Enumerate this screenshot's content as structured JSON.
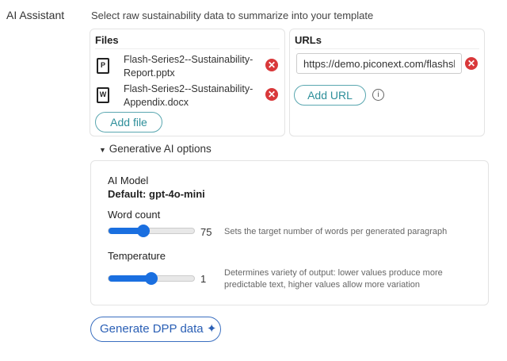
{
  "section_label": "AI Assistant",
  "intro": "Select raw sustainability data to summarize into your template",
  "files": {
    "title": "Files",
    "items": [
      {
        "icon": "P",
        "name_line1": "Flash-Series2--Sustainability-",
        "name_line2": "Report.pptx"
      },
      {
        "icon": "W",
        "name_line1": "Flash-Series2--Sustainability-",
        "name_line2": "Appendix.docx"
      }
    ],
    "add_label": "Add file"
  },
  "urls": {
    "title": "URLs",
    "value": "https://demo.piconext.com/flashsh",
    "add_label": "Add URL"
  },
  "options_toggle": "Generative AI options",
  "options": {
    "model_label": "AI Model",
    "model_value": "Default: gpt-4o-mini",
    "word_count": {
      "label": "Word count",
      "value": "75",
      "slider_percent": 41,
      "hint": "Sets the target number of words per generated paragraph"
    },
    "temperature": {
      "label": "Temperature",
      "value": "1",
      "slider_percent": 50,
      "hint": "Determines variety of output: lower values produce more predictable text, higher values allow more variation"
    }
  },
  "generate_label": "Generate DPP data",
  "colors": {
    "accent": "#1a6fe0",
    "remove": "#d9383a",
    "secondary_button": "#2e8f9a"
  }
}
